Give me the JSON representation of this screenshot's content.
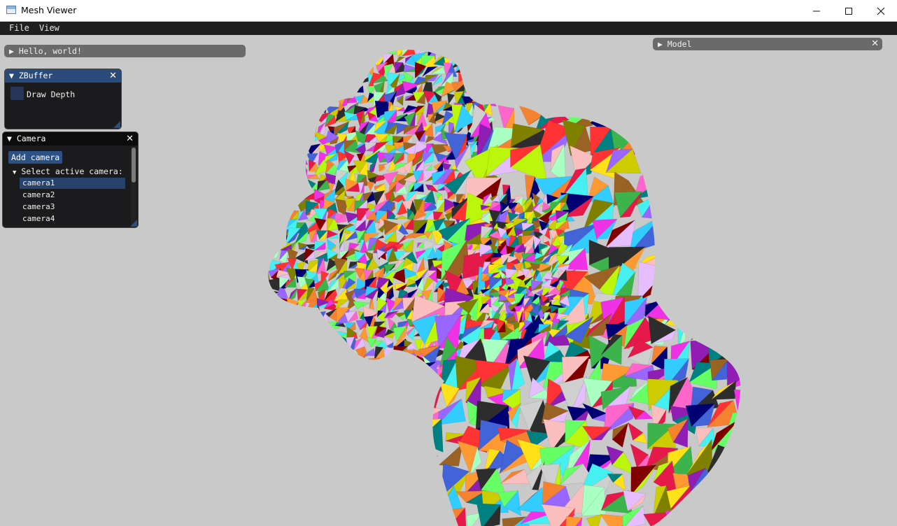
{
  "window": {
    "title": "Mesh Viewer",
    "minimize_icon": "minimize-icon",
    "maximize_icon": "maximize-icon",
    "close_icon": "close-icon"
  },
  "menubar": {
    "items": [
      "File",
      "View"
    ]
  },
  "hello_window": {
    "title": "Hello, world!",
    "collapsed": true,
    "arrow_icon": "triangle-right-icon"
  },
  "model_window": {
    "title": "Model",
    "collapsed": true,
    "arrow_icon": "triangle-right-icon",
    "close_icon": "close-icon"
  },
  "zbuffer_window": {
    "title": "ZBuffer",
    "close_icon": "close-icon",
    "checkbox_label": "Draw Depth",
    "checked": false
  },
  "camera_window": {
    "title": "Camera",
    "close_icon": "close-icon",
    "add_button": "Add camera",
    "tree_label": "Select active camera:",
    "cameras": [
      "camera1",
      "camera2",
      "camera3",
      "camera4"
    ],
    "selected": "camera1"
  },
  "colors": {
    "background": "#c9c9c9",
    "active_title": "#2a4a7a",
    "panel_bg": "#1b1b1d",
    "menubar": "#1f1f1f"
  }
}
